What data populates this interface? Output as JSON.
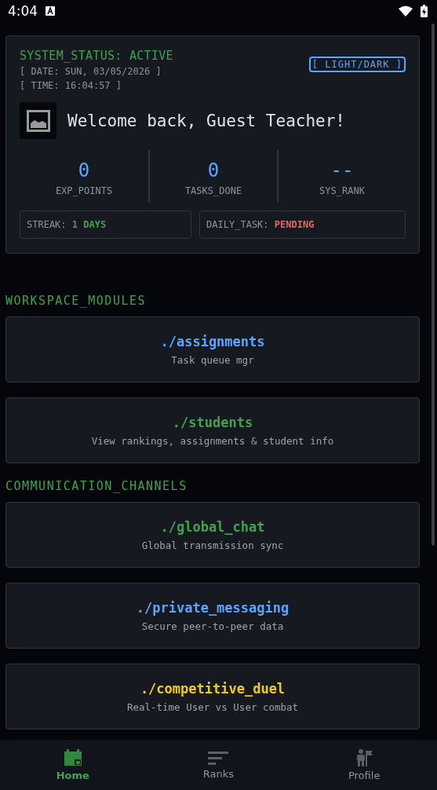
{
  "status_bar": {
    "time": "4:04"
  },
  "dashboard": {
    "status": "SYSTEM_STATUS: ACTIVE",
    "date": "[ DATE: SUN, 03/05/2026 ]",
    "time": "[ TIME: 16:04:57 ]",
    "theme_button": "[ LIGHT/DARK ]",
    "welcome": "Welcome back, Guest Teacher!",
    "stats": [
      {
        "value": "0",
        "label": "EXP_POINTS"
      },
      {
        "value": "0",
        "label": "TASKS_DONE"
      },
      {
        "value": "--",
        "label": "SYS_RANK"
      }
    ],
    "badges": [
      {
        "label": "STREAK:",
        "value": "1 DAYS",
        "color": "#3fa34d"
      },
      {
        "label": "DAILY_TASK:",
        "value": "PENDING",
        "color": "#f0625a"
      }
    ]
  },
  "sections": [
    {
      "title": "WORKSPACE_MODULES",
      "modules": [
        {
          "title": "./assignments",
          "subtitle": "Task queue mgr",
          "color": "#58a6ff"
        },
        {
          "title": "./students",
          "subtitle": "View rankings, assignments & student info",
          "color": "#3fa34d"
        }
      ]
    },
    {
      "title": "COMMUNICATION_CHANNELS",
      "modules": [
        {
          "title": "./global_chat",
          "subtitle": "Global transmission sync",
          "color": "#3fa34d"
        },
        {
          "title": "./private_messaging",
          "subtitle": "Secure peer-to-peer data",
          "color": "#58a6ff"
        },
        {
          "title": "./competitive_duel",
          "subtitle": "Real-time User vs User combat",
          "color": "#f2cc0f"
        }
      ]
    }
  ],
  "nav": [
    {
      "label": "Home",
      "kind": "home",
      "selected": true
    },
    {
      "label": "Ranks",
      "kind": "ranks",
      "selected": false
    },
    {
      "label": "Profile",
      "kind": "profile",
      "selected": false
    }
  ]
}
